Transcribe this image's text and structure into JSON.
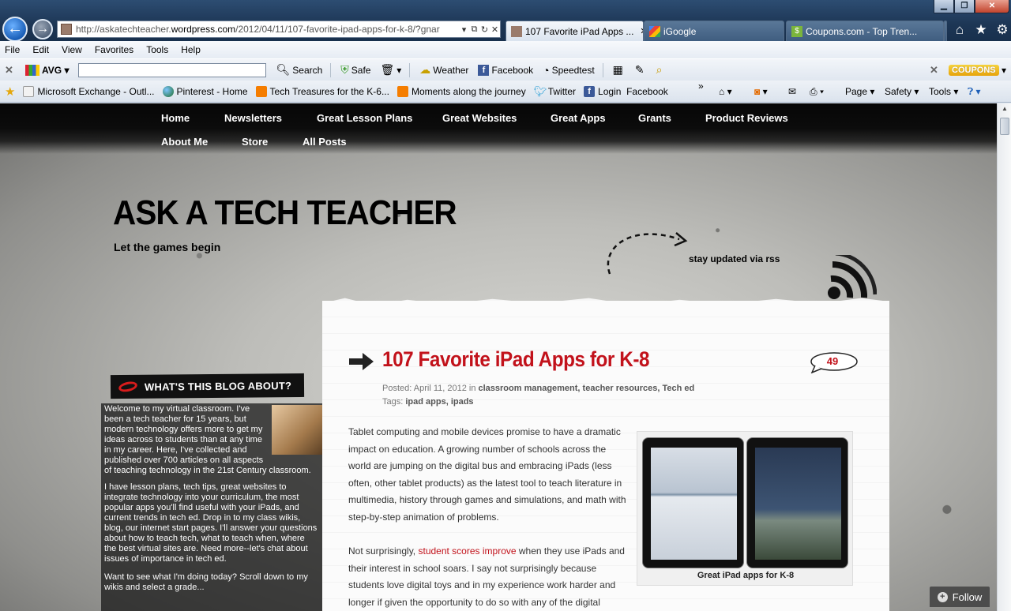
{
  "browser": {
    "address_url_prefix": "http://askatechteacher.",
    "address_url_domain": "wordpress.com",
    "address_url_path": "/2012/04/11/107-favorite-ipad-apps-for-k-8/?gnar",
    "tabs": [
      {
        "label": "107 Favorite iPad Apps ...",
        "active": true
      },
      {
        "label": "iGoogle",
        "active": false
      },
      {
        "label": "Coupons.com - Top Tren...",
        "active": false
      }
    ],
    "menu": [
      "File",
      "Edit",
      "View",
      "Favorites",
      "Tools",
      "Help"
    ],
    "toolbar": {
      "avg_label": "AVG",
      "search_label": "Search",
      "safe_label": "Safe",
      "weather_label": "Weather",
      "facebook_label": "Facebook",
      "speedtest_label": "Speedtest",
      "coupons_label": "COUPONS"
    },
    "favorites": [
      "Microsoft Exchange - Outl...",
      "Pinterest - Home",
      "Tech Treasures for the K-6...",
      "Moments along the journey",
      "Twitter",
      "Login",
      "Facebook"
    ],
    "commands": {
      "page": "Page",
      "safety": "Safety",
      "tools": "Tools"
    }
  },
  "site": {
    "nav_row1": [
      "Home",
      "Newsletters",
      "Great Lesson Plans",
      "Great Websites",
      "Great Apps",
      "Grants",
      "Product Reviews"
    ],
    "nav_row2": [
      "About Me",
      "Store",
      "All Posts"
    ],
    "title": "ASK A TECH TEACHER",
    "tagline": "Let the games begin",
    "rss_label": "stay updated via rss"
  },
  "sidebar": {
    "header": "WHAT'S THIS BLOG ABOUT?",
    "p1_lines": [
      "Welcome to my virtual classroom. I've",
      "been a tech teacher for 15 years, but",
      "modern technology offers more to get my",
      "ideas across to students than at any time",
      "in my career. Here, I've collected and",
      "published over 700 articles on all aspects",
      "of teaching technology in the 21st Century classroom."
    ],
    "p2_lines": [
      "I have lesson plans, tech tips, great websites to",
      "integrate technology into your curriculum, the most",
      "popular apps you'll find useful with your iPads, and",
      "current trends in tech ed. Drop in to my class wikis,",
      "blog, our internet start pages. I'll answer your questions",
      "about how to teach tech, what to teach when, where",
      "the best virtual sites are. Need more--let's chat about",
      "issues of importance in tech ed."
    ],
    "p3_lines": [
      "Want to see what I'm doing today? Scroll down to my",
      "wikis and select a grade..."
    ]
  },
  "post": {
    "title": "107 Favorite iPad Apps for K-8",
    "comment_count": "49",
    "posted_prefix": "Posted: April 11, 2012 in ",
    "categories": "classroom management, teacher resources, Tech ed",
    "tags_prefix": "Tags: ",
    "tags": "ipad apps, ipads",
    "p1": "Tablet computing and mobile devices promise to have a dramatic impact on education. A growing number of schools across the world are jumping on the digital bus and embracing  iPads (less often, other tablet products) as the latest tool to teach literature in multimedia, history through games and simulations, and math with step-by-step animation of problems.",
    "p2_before": "Not surprisingly, ",
    "p2_link": "student scores improve",
    "p2_after": " when they use iPads and their interest in school soars. I say not surprisingly because students love digital toys and in my experience work harder and longer if given the opportunity to do so with any of the digital",
    "figure_caption": "Great iPad apps for K-8"
  },
  "follow_label": "Follow",
  "colors": {
    "accent_red": "#c2121b",
    "nav_bg": "#0a0a0a",
    "ie_frame": "#1d3655"
  }
}
